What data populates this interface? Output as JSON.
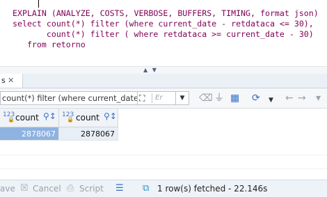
{
  "editor": {
    "lines": [
      "EXPLAIN (ANALYZE, COSTS, VERBOSE, BUFFERS, TIMING, format json)",
      "select count(*) filter (where current_date - retdataca <= 30),",
      "       count(*) filter ( where retdataca >= current_date - 30)",
      "   from retorno"
    ]
  },
  "results_tab": {
    "label": "s"
  },
  "filter": {
    "value": " count(*) filter (where current_date - ",
    "history_hint": "Er"
  },
  "grid": {
    "columns": [
      {
        "type_icon": "123",
        "label": "count"
      },
      {
        "type_icon": "123",
        "label": "count"
      }
    ],
    "rows": [
      [
        "2878067",
        "2878067"
      ]
    ]
  },
  "statusbar": {
    "save_label": "ave",
    "cancel_label": "Cancel",
    "script_label": "Script",
    "status_text": "1 row(s) fetched - 22.146s"
  },
  "colors": {
    "keyword": "#7f0055",
    "selection": "#8fb3e0",
    "accent": "#3570c8"
  }
}
